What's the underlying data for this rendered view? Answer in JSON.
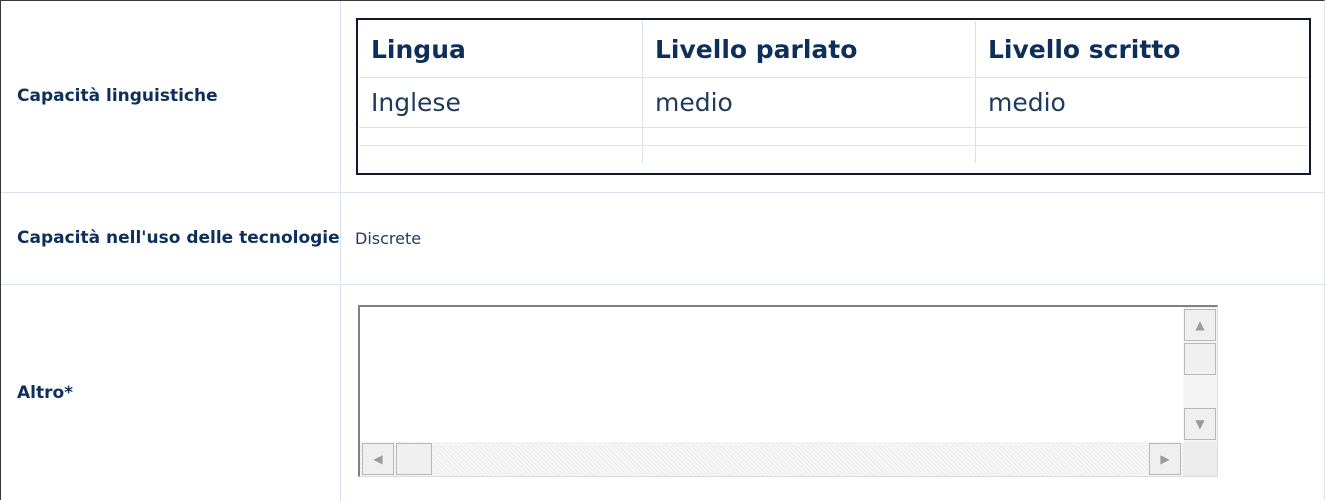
{
  "rows": {
    "languages": {
      "label": "Capacità linguistiche",
      "table": {
        "headers": [
          "Lingua",
          "Livello parlato",
          "Livello scritto"
        ],
        "rows": [
          [
            "Inglese",
            "medio",
            "medio"
          ],
          [
            "",
            "",
            ""
          ],
          [
            "",
            "",
            ""
          ]
        ]
      }
    },
    "technology": {
      "label": "Capacità nell'uso delle tecnologie",
      "value": "Discrete"
    },
    "other": {
      "label": "Altro*",
      "value": ""
    }
  },
  "icons": {
    "scroll_up": "triangle-up-icon",
    "scroll_down": "triangle-down-icon",
    "scroll_left": "triangle-left-icon",
    "scroll_right": "triangle-right-icon"
  }
}
